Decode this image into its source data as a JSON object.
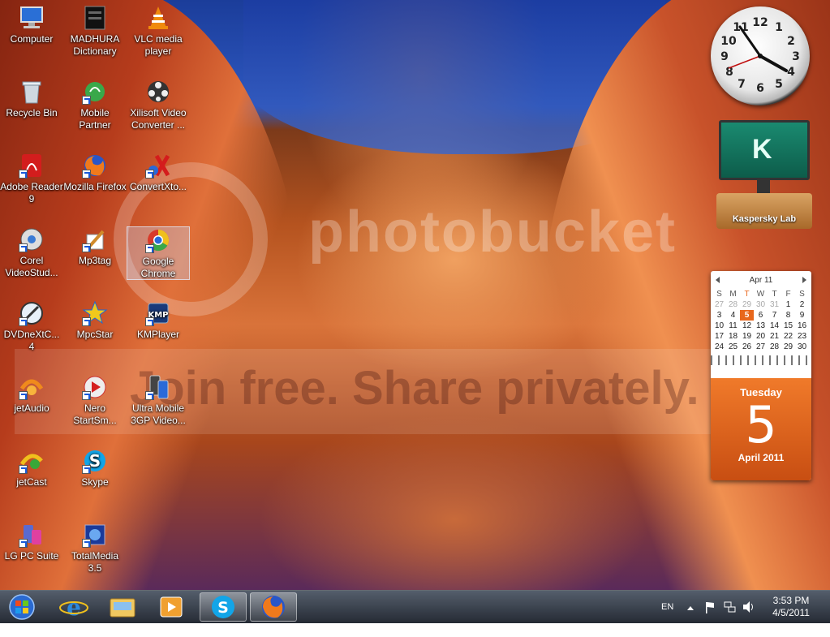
{
  "desktop": {
    "watermark_text": "photobucket",
    "watermark_slogan": "Join free. Share privately.",
    "icons": [
      {
        "label": "Computer"
      },
      {
        "label": "Recycle Bin"
      },
      {
        "label": "Adobe Reader 9"
      },
      {
        "label": "Corel VideoStud..."
      },
      {
        "label": "DVDneXtC... 4"
      },
      {
        "label": "jetAudio"
      },
      {
        "label": "jetCast"
      },
      {
        "label": "LG PC Suite"
      },
      {
        "label": "MADHURA Dictionary"
      },
      {
        "label": "Mobile Partner"
      },
      {
        "label": "Mozilla Firefox"
      },
      {
        "label": "Mp3tag"
      },
      {
        "label": "MpcStar"
      },
      {
        "label": "Nero StartSm..."
      },
      {
        "label": "Skype"
      },
      {
        "label": "TotalMedia 3.5"
      },
      {
        "label": "VLC media player"
      },
      {
        "label": "Xilisoft Video Converter ..."
      },
      {
        "label": "ConvertXto..."
      },
      {
        "label": "Google Chrome"
      },
      {
        "label": "KMPlayer"
      },
      {
        "label": "Ultra Mobile 3GP Video..."
      }
    ]
  },
  "gadgets": {
    "clock": {
      "numbers": [
        "12",
        "1",
        "2",
        "3",
        "4",
        "5",
        "6",
        "7",
        "8",
        "9",
        "10",
        "11"
      ],
      "time": "3:53"
    },
    "kaspersky": {
      "label": "Kaspersky Lab",
      "logo": "K"
    },
    "calendar": {
      "month_label": "Apr 11",
      "weekdays": [
        "S",
        "M",
        "T",
        "W",
        "T",
        "F",
        "S"
      ],
      "weeks": [
        [
          "27",
          "28",
          "29",
          "30",
          "31",
          "1",
          "2"
        ],
        [
          "3",
          "4",
          "5",
          "6",
          "7",
          "8",
          "9"
        ],
        [
          "10",
          "11",
          "12",
          "13",
          "14",
          "15",
          "16"
        ],
        [
          "17",
          "18",
          "19",
          "20",
          "21",
          "22",
          "23"
        ],
        [
          "24",
          "25",
          "26",
          "27",
          "28",
          "29",
          "30"
        ]
      ],
      "today": "5",
      "day_name": "Tuesday",
      "day_number": "5",
      "month_year": "April 2011"
    }
  },
  "taskbar": {
    "items": [
      {
        "name": "start-button"
      },
      {
        "name": "internet-explorer"
      },
      {
        "name": "windows-explorer"
      },
      {
        "name": "media-player"
      },
      {
        "name": "skype"
      },
      {
        "name": "firefox"
      }
    ],
    "language": "EN",
    "time": "3:53 PM",
    "date": "4/5/2011"
  },
  "colors": {
    "accent": "#e8671c",
    "kaspersky": "#1a8a70"
  }
}
